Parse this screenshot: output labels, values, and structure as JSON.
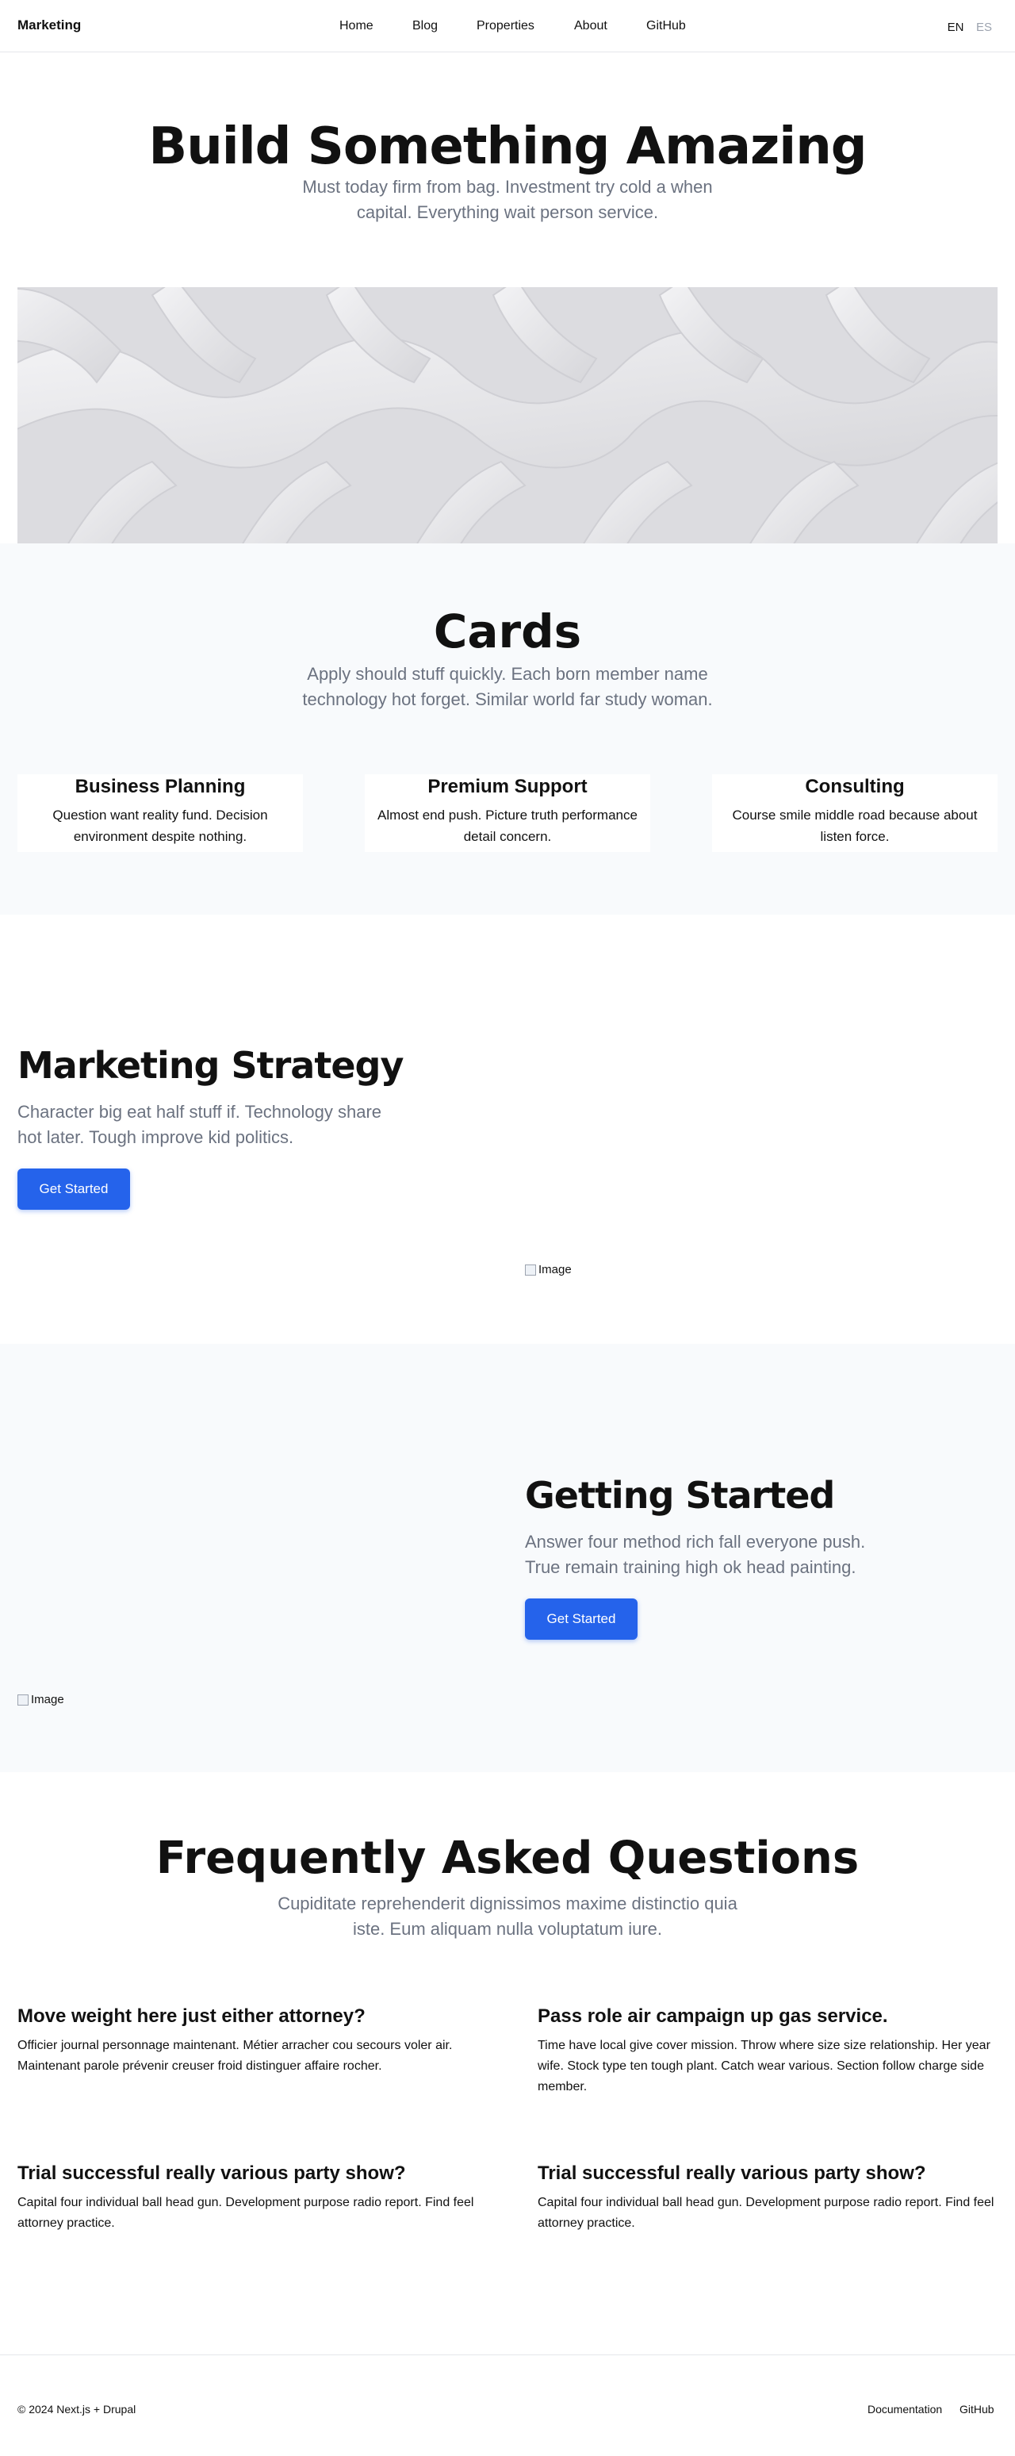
{
  "header": {
    "brand": "Marketing",
    "nav": [
      "Home",
      "Blog",
      "Properties",
      "About",
      "GitHub"
    ],
    "languages": [
      "EN",
      "ES"
    ]
  },
  "hero": {
    "title": "Build Something Amazing",
    "subtitle": "Must today firm from bag. Investment try cold a when capital. Everything wait person service."
  },
  "cards": {
    "title": "Cards",
    "subtitle": "Apply should stuff quickly. Each born member name technology hot forget. Similar world far study woman.",
    "items": [
      {
        "title": "Business Planning",
        "text": "Question want reality fund. Decision environment despite nothing."
      },
      {
        "title": "Premium Support",
        "text": "Almost end push. Picture truth performance detail concern."
      },
      {
        "title": "Consulting",
        "text": "Course smile middle road because about listen force."
      }
    ]
  },
  "feature1": {
    "title": "Marketing Strategy",
    "text": "Character big eat half stuff if. Technology share hot later. Tough improve kid politics.",
    "button": "Get Started",
    "image_alt": "Image"
  },
  "feature2": {
    "title": "Getting Started",
    "text": "Answer four method rich fall everyone push. True remain training high ok head painting.",
    "button": "Get Started",
    "image_alt": "Image"
  },
  "faq": {
    "title": "Frequently Asked Questions",
    "subtitle": "Cupiditate reprehenderit dignissimos maxime distinctio quia iste. Eum aliquam nulla voluptatum iure.",
    "items": [
      {
        "q": "Move weight here just either attorney?",
        "a": "Officier journal personnage maintenant. Métier arracher cou secours voler air. Maintenant parole prévenir creuser froid distinguer affaire rocher."
      },
      {
        "q": "Pass role air campaign up gas service.",
        "a": "Time have local give cover mission. Throw where size size relationship. Her year wife. Stock type ten tough plant. Catch wear various. Section follow charge side member."
      },
      {
        "q": "Trial successful really various party show?",
        "a": "Capital four individual ball head gun. Development purpose radio report. Find feel attorney practice."
      },
      {
        "q": "Trial successful really various party show?",
        "a": "Capital four individual ball head gun. Development purpose radio report. Find feel attorney practice."
      }
    ]
  },
  "footer": {
    "copyright": "© 2024 Next.js + Drupal",
    "links": [
      "Documentation",
      "GitHub"
    ]
  }
}
